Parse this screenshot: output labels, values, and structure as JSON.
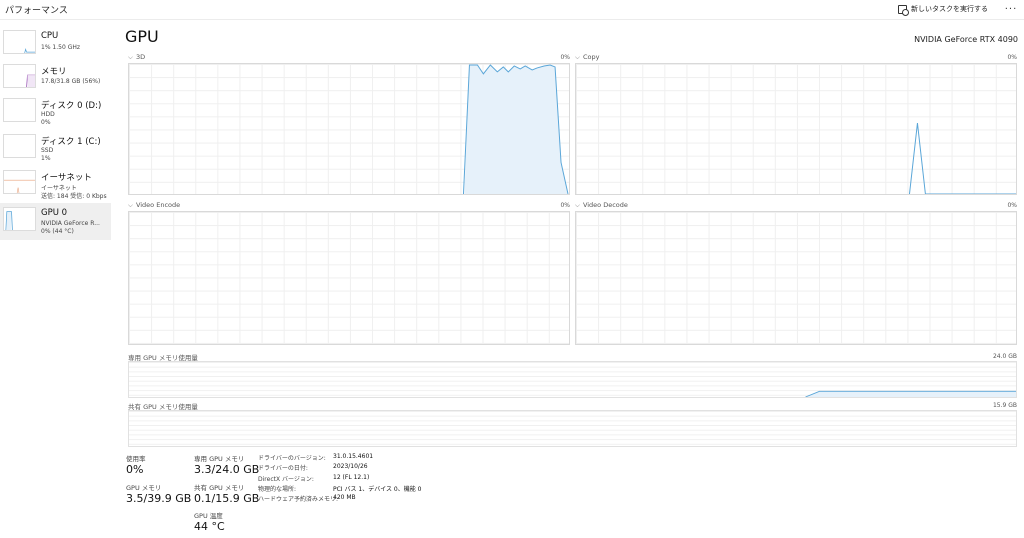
{
  "app": {
    "title": "パフォーマンス",
    "new_task_label": "新しいタスクを実行する",
    "more_label": "···",
    "new_task_icon": "run-task-icon",
    "more_icon": "more-icon"
  },
  "sidebar": {
    "items": [
      {
        "name": "CPU",
        "sub1": "1%  1.50 GHz",
        "sub2": ""
      },
      {
        "name": "メモリ",
        "sub1": "17.8/31.8 GB (56%)",
        "sub2": ""
      },
      {
        "name": "ディスク 0 (D:)",
        "sub1": "HDD",
        "sub2": "0%"
      },
      {
        "name": "ディスク 1 (C:)",
        "sub1": "SSD",
        "sub2": "1%"
      },
      {
        "name": "イーサネット",
        "sub1": "イーサネット",
        "sub2": "送信: 184 受信: 0 Kbps"
      },
      {
        "name": "GPU 0",
        "sub1": "NVIDIA GeForce R...",
        "sub2": "0% (44 °C)"
      }
    ]
  },
  "main": {
    "title": "GPU",
    "gpu_name": "NVIDIA GeForce RTX 4090",
    "engines": [
      {
        "label": "3D",
        "pct": "0%"
      },
      {
        "label": "Copy",
        "pct": "0%"
      },
      {
        "label": "Video Encode",
        "pct": "0%"
      },
      {
        "label": "Video Decode",
        "pct": "0%"
      }
    ],
    "dedicated_mem": {
      "label": "専用 GPU メモリ使用量",
      "max": "24.0 GB"
    },
    "shared_mem": {
      "label": "共有 GPU メモリ使用量",
      "max": "15.9 GB"
    }
  },
  "stats": {
    "usage_label": "使用率",
    "usage_value": "0%",
    "gpu_mem_label": "GPU メモリ",
    "gpu_mem_value": "3.5/39.9 GB",
    "dedicated_label": "専用 GPU メモリ",
    "dedicated_value": "3.3/24.0 GB",
    "shared_label": "共有 GPU メモリ",
    "shared_value": "0.1/15.9 GB",
    "temp_label": "GPU 温度",
    "temp_value": "44 °C"
  },
  "info": [
    {
      "key": "ドライバーのバージョン:",
      "value": "31.0.15.4601"
    },
    {
      "key": "ドライバーの日付:",
      "value": "2023/10/26"
    },
    {
      "key": "DirectX バージョン:",
      "value": "12 (FL 12.1)"
    },
    {
      "key": "物理的な場所:",
      "value": "PCI バス 1、デバイス 0、機能 0"
    },
    {
      "key": "ハードウェア予約済みメモリ:",
      "value": "420 MB"
    }
  ],
  "colors": {
    "gpu_line": "#5aa6d8",
    "gpu_fill": "#e6f1fa",
    "memory_line": "#9b59b6",
    "ethernet_line": "#e8a07a"
  }
}
